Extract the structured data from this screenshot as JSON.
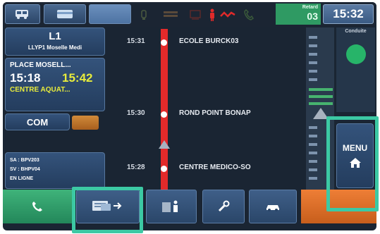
{
  "colors": {
    "screen_bg": "#1a2533",
    "button_blue": "#3a5a83",
    "route_line": "#e32a2a",
    "accent_green": "#2f9a63",
    "text_yellow": "#e8ec3c",
    "highlight_teal": "#3cc9a4",
    "bottom_orange": "#e06a2a"
  },
  "topbar": {
    "icons": [
      "bus-icon",
      "card-icon",
      "bell-icon",
      "bars-icon",
      "stop-sign-icon",
      "person-icon",
      "gesture-icon",
      "phone-icon"
    ],
    "retard_label": "Retard",
    "retard_value": "03",
    "clock": "15:32"
  },
  "line_panel": {
    "line": "L1",
    "line_desc": "LLYP1 Moselle Medi"
  },
  "trip_panel": {
    "from": "PLACE MOSELL...",
    "dep_time": "15:18",
    "arr_time": "15:42",
    "to": "CENTRE AQUAT..."
  },
  "com_button": {
    "label": "COM"
  },
  "info_panel": {
    "lines": [
      "SA : BPV203",
      "SV : BHPV04",
      "EN LIGNE"
    ]
  },
  "stops": [
    {
      "time": "15:31",
      "name": "ECOLE BURCK03"
    },
    {
      "time": "15:30",
      "name": "ROND POINT BONAP"
    },
    {
      "time": "15:28",
      "name": "CENTRE MEDICO-SO"
    }
  ],
  "conduite": {
    "label": "Conduite"
  },
  "menu_button": {
    "label": "MENU"
  },
  "bottom_bar": {
    "items": [
      "phone-icon",
      "message-transfer-icon",
      "passenger-icon",
      "wrench-icon",
      "car-icon",
      "orange-action"
    ]
  }
}
